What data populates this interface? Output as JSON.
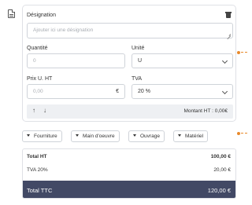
{
  "line_item": {
    "designation_label": "Désignation",
    "designation_placeholder": "Ajouter ici une désignation",
    "quantity_label": "Quantité",
    "quantity_placeholder": "0",
    "unit_label": "Unité",
    "unit_value": "U",
    "price_label": "Prix U. HT",
    "price_placeholder": "0,00",
    "price_currency": "€",
    "vat_label": "TVA",
    "vat_value": "20 %",
    "arrow_up": "↑",
    "arrow_down": "↓",
    "montant_label": "Montant HT : 0,00€"
  },
  "add_buttons": [
    "Fourniture",
    "Main d'oeuvre",
    "Ouvrage",
    "Matériel"
  ],
  "totals": {
    "total_ht_label": "Total HT",
    "total_ht_value": "100,00 €",
    "tva_label": "TVA 20%",
    "tva_value": "20,00 €",
    "total_ttc_label": "Total TTC",
    "total_ttc_value": "120,00 €"
  },
  "icons": [
    "document-icon",
    "trash-icon",
    "chevron-down-icon",
    "caret-down-icon",
    "arrow-up-icon",
    "arrow-down-icon"
  ],
  "colors": {
    "accent": "#e8892b",
    "ttc_background": "#424965"
  }
}
